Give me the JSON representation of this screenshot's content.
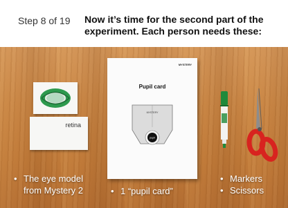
{
  "header": {
    "step_label": "Step 8 of 19",
    "title": "Now it’s time for the second part of the experiment. Each person needs these:"
  },
  "photo": {
    "retina_card_label": "retina",
    "pupil_sheet": {
      "brand": "MYSTERY",
      "title": "Pupil card",
      "template_brand": "MYSTERY",
      "pupil_label": "pupil"
    }
  },
  "captions": {
    "eye_model": {
      "bullet": "•",
      "line1": "The eye model",
      "line2": "from Mystery 2"
    },
    "pupil_card": {
      "bullet": "•",
      "text": "1 “pupil card”"
    },
    "supplies": {
      "bullet1": "•",
      "item1": "Markers",
      "bullet2": "•",
      "item2": "Scissors"
    }
  },
  "colors": {
    "marker_green": "#1f8a3b",
    "scissors_red": "#d8231f",
    "ring_green": "#2e9a4e",
    "table_wood": "#c98645"
  },
  "icons": [
    "eye-model-ring-icon",
    "green-marker-icon",
    "scissors-icon"
  ]
}
